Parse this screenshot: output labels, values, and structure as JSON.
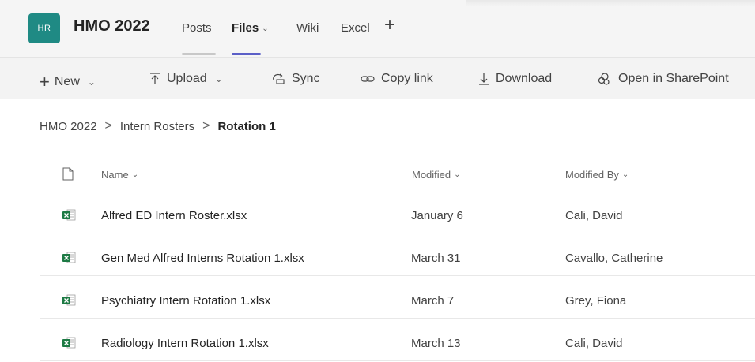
{
  "header": {
    "avatar_initials": "HR",
    "avatar_color": "#1f8a84",
    "team_name": "HMO 2022",
    "tabs": [
      {
        "label": "Posts",
        "active": false
      },
      {
        "label": "Files",
        "active": true,
        "has_dropdown": true
      },
      {
        "label": "Wiki",
        "active": false
      },
      {
        "label": "Excel",
        "active": false
      }
    ],
    "add_tab_icon": "plus-icon",
    "accent_color": "#5b5fc7"
  },
  "toolbar": {
    "new_label": "New",
    "upload_label": "Upload",
    "sync_label": "Sync",
    "copy_link_label": "Copy link",
    "download_label": "Download",
    "open_sharepoint_label": "Open in SharePoint"
  },
  "breadcrumb": {
    "items": [
      "HMO 2022",
      "Intern Rosters",
      "Rotation 1"
    ]
  },
  "table": {
    "columns": {
      "type_icon": "file-icon",
      "name": "Name",
      "modified": "Modified",
      "modified_by": "Modified By"
    },
    "rows": [
      {
        "icon": "excel-file-icon",
        "name": "Alfred ED Intern Roster.xlsx",
        "modified": "January 6",
        "modified_by": "Cali, David"
      },
      {
        "icon": "excel-file-icon",
        "name": "Gen Med Alfred Interns Rotation 1.xlsx",
        "modified": "March 31",
        "modified_by": "Cavallo, Catherine"
      },
      {
        "icon": "excel-file-icon",
        "name": "Psychiatry Intern Rotation 1.xlsx",
        "modified": "March 7",
        "modified_by": "Grey, Fiona"
      },
      {
        "icon": "excel-file-icon",
        "name": "Radiology Intern Rotation 1.xlsx",
        "modified": "March 13",
        "modified_by": "Cali, David"
      }
    ]
  }
}
